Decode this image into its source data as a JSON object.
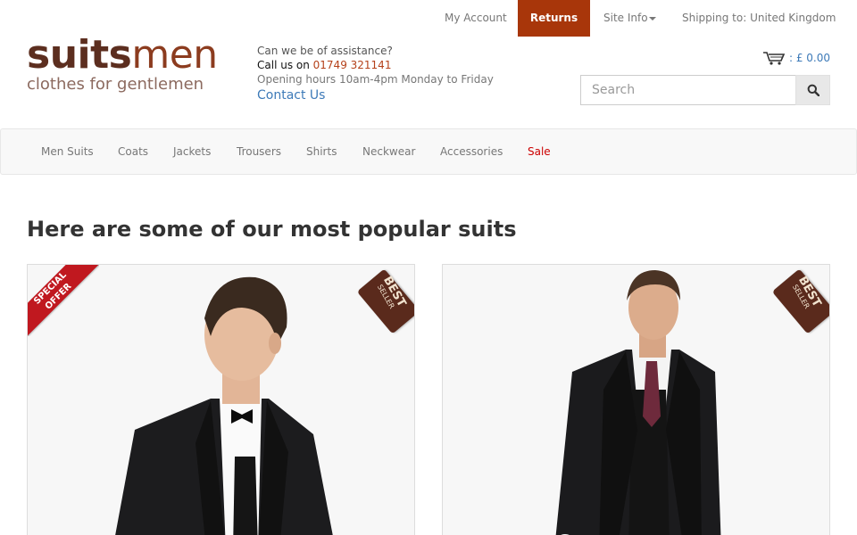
{
  "topbar": {
    "account": "My Account",
    "returns": "Returns",
    "site_info": "Site Info",
    "shipping": "Shipping to: United Kingdom"
  },
  "logo": {
    "word_part1": "suits",
    "word_part2": "men",
    "tagline": "clothes for gentlemen"
  },
  "contact": {
    "question": "Can we be of assistance?",
    "call_prefix": "Call us on ",
    "phone": "01749 321141",
    "hours": "Opening hours 10am-4pm Monday to Friday",
    "contact_link": "Contact Us"
  },
  "cart": {
    "total": ": £ 0.00"
  },
  "search": {
    "placeholder": "Search"
  },
  "nav": {
    "items": [
      "Men Suits",
      "Coats",
      "Jackets",
      "Trousers",
      "Shirts",
      "Neckwear",
      "Accessories",
      "Sale"
    ]
  },
  "main": {
    "heading": "Here are some of our most popular suits"
  },
  "products": [
    {
      "ribbon_line1": "SPECIAL",
      "ribbon_line2": "OFFER",
      "tag_line1": "BEST",
      "tag_line2": "SELLER"
    },
    {
      "tag_line1": "BEST",
      "tag_line2": "SELLER"
    }
  ],
  "colors": {
    "accent": "#a8360a",
    "link": "#3d7ab8",
    "sale": "#cc0000",
    "ribbon": "#c0181f",
    "tag": "#5a2a1c"
  },
  "icons": [
    "cart-icon",
    "search-icon",
    "caret-down-icon"
  ]
}
